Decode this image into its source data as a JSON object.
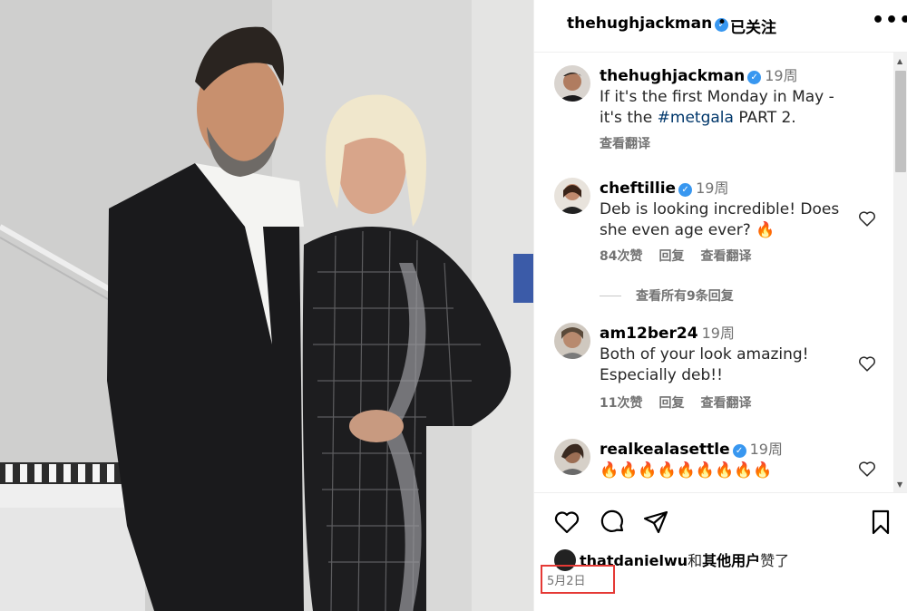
{
  "post": {
    "photo_alt": "",
    "author": "thehughjackman",
    "follow_status": "已关注",
    "more_label": "•••"
  },
  "caption": {
    "user": "thehughjackman",
    "time": "19周",
    "text_before": "If it's the first Monday in May - it's the ",
    "hashtag": "#metgala",
    "text_after": " PART 2.",
    "translate": "查看翻译"
  },
  "comments": [
    {
      "user": "cheftillie",
      "verified": true,
      "time": "19周",
      "text": "Deb is looking incredible! Does she even age ever? 🔥",
      "likes": "84次赞",
      "reply": "回复",
      "translate": "查看翻译"
    },
    {
      "user": "am12ber24",
      "verified": false,
      "time": "19周",
      "text": "Both of your look amazing! Especially deb!!",
      "likes": "11次赞",
      "reply": "回复",
      "translate": "查看翻译"
    },
    {
      "user": "realkealasettle",
      "verified": true,
      "time": "19周",
      "text": "🔥🔥🔥🔥🔥🔥🔥🔥🔥",
      "likes": "",
      "reply": "",
      "translate": ""
    }
  ],
  "view_all_replies": "查看所有9条回复",
  "likes_line": {
    "user": "thatdanielwu",
    "connector": "和",
    "others": "其他用户",
    "suffix": "赞了"
  },
  "date": "5月2日",
  "colors": {
    "verified": "#3897f0",
    "hashtag": "#00376b",
    "secondary_text": "#737373",
    "highlight_box": "#e53935"
  },
  "icons": {
    "heart": "heart-icon",
    "comment": "comment-icon",
    "share": "share-icon",
    "save": "bookmark-icon",
    "more": "more-icon",
    "verified": "verified-badge-icon"
  }
}
